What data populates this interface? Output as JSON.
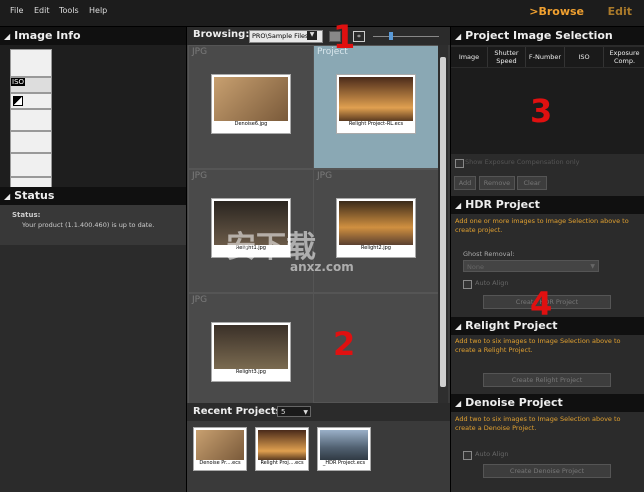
{
  "menu": {
    "file": "File",
    "edit": "Edit",
    "tools": "Tools",
    "help": "Help",
    "browse": ">Browse",
    "edit_mode": "Edit"
  },
  "left": {
    "image_info_title": "Image Info",
    "iso_label": "ISO",
    "status_title": "Status",
    "status_label": "Status:",
    "status_message": "Your product (1.1.400.460) is up to date."
  },
  "center": {
    "browsing_label": "Browsing:",
    "path_value": "PRO\\Sample Files\\",
    "cells": [
      {
        "type_label": "JPG",
        "caption": "Denoise6.jpg"
      },
      {
        "type_label": "Project",
        "caption": "Relight Project-RL.ecs"
      },
      {
        "type_label": "JPG",
        "caption": "Relight1.jpg"
      },
      {
        "type_label": "JPG",
        "caption": "Relight2.jpg"
      },
      {
        "type_label": "JPG",
        "caption": "Relight3.jpg"
      }
    ],
    "recent_label": "Recent Projects:",
    "recent_count": "5",
    "recent": [
      {
        "caption": "Denoise Pr....ecs"
      },
      {
        "caption": "Relight Proj....ecs"
      },
      {
        "caption": "_HDR Project.ecs"
      }
    ]
  },
  "right": {
    "selection_title": "Project Image Selection",
    "columns": [
      "Image",
      "Shutter Speed",
      "F-Number",
      "ISO",
      "Exposure Comp."
    ],
    "show_exposure": "Show Exposure Compensation only",
    "add": "Add",
    "remove": "Remove",
    "clear": "Clear",
    "hdr_title": "HDR Project",
    "hdr_desc": "Add one or more images to Image Selection above to create project.",
    "ghost_label": "Ghost Removal:",
    "ghost_value": "None",
    "auto_align": "Auto Align",
    "create_project": "Create HDR Project",
    "relight_title": "Relight Project",
    "relight_desc": "Add two to six images to Image Selection above to create a Relight Project.",
    "create_relight": "Create Relight Project",
    "denoise_title": "Denoise Project",
    "denoise_desc": "Add two to six images to Image Selection above to create a Denoise Project.",
    "denoise_auto_align": "Auto Align",
    "create_denoise": "Create Denoise Project"
  },
  "annotations": {
    "one": "1",
    "two": "2",
    "three": "3",
    "four": "4"
  },
  "watermark": {
    "main": "安下载",
    "sub": "anxz.com"
  },
  "colors": {
    "accent": "#f0a030",
    "highlight": "#e01010"
  }
}
